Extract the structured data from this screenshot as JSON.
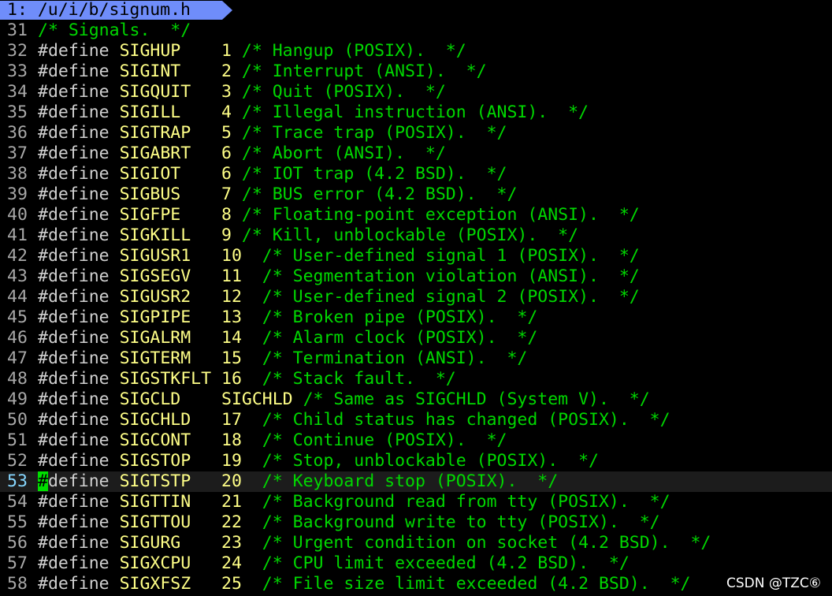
{
  "tab": {
    "label": "1: /u/i/b/signum.h"
  },
  "watermark": "CSDN @TZC⑥",
  "colors": {
    "background": "#000000",
    "tab": "#6f8dfa",
    "line_number": "#a8a8a8",
    "current_line_number": "#87d7ff",
    "keyword": "#d0d0d0",
    "identifier": "#ffff87",
    "comment": "#00d700",
    "cursor": "#00e000"
  },
  "lines": [
    {
      "num": "31",
      "comment": "/* Signals.  */"
    },
    {
      "num": "32",
      "kw": "#define",
      "name": "SIGHUP",
      "val": "1",
      "comment": "/* Hangup (POSIX).  */"
    },
    {
      "num": "33",
      "kw": "#define",
      "name": "SIGINT",
      "val": "2",
      "comment": "/* Interrupt (ANSI).  */"
    },
    {
      "num": "34",
      "kw": "#define",
      "name": "SIGQUIT",
      "val": "3",
      "comment": "/* Quit (POSIX).  */"
    },
    {
      "num": "35",
      "kw": "#define",
      "name": "SIGILL",
      "val": "4",
      "comment": "/* Illegal instruction (ANSI).  */"
    },
    {
      "num": "36",
      "kw": "#define",
      "name": "SIGTRAP",
      "val": "5",
      "comment": "/* Trace trap (POSIX).  */"
    },
    {
      "num": "37",
      "kw": "#define",
      "name": "SIGABRT",
      "val": "6",
      "comment": "/* Abort (ANSI).  */"
    },
    {
      "num": "38",
      "kw": "#define",
      "name": "SIGIOT",
      "val": "6",
      "comment": "/* IOT trap (4.2 BSD).  */"
    },
    {
      "num": "39",
      "kw": "#define",
      "name": "SIGBUS",
      "val": "7",
      "comment": "/* BUS error (4.2 BSD).  */"
    },
    {
      "num": "40",
      "kw": "#define",
      "name": "SIGFPE",
      "val": "8",
      "comment": "/* Floating-point exception (ANSI).  */"
    },
    {
      "num": "41",
      "kw": "#define",
      "name": "SIGKILL",
      "val": "9",
      "comment": "/* Kill, unblockable (POSIX).  */"
    },
    {
      "num": "42",
      "kw": "#define",
      "name": "SIGUSR1",
      "val": "10",
      "comment": " /* User-defined signal 1 (POSIX).  */"
    },
    {
      "num": "43",
      "kw": "#define",
      "name": "SIGSEGV",
      "val": "11",
      "comment": " /* Segmentation violation (ANSI).  */"
    },
    {
      "num": "44",
      "kw": "#define",
      "name": "SIGUSR2",
      "val": "12",
      "comment": " /* User-defined signal 2 (POSIX).  */"
    },
    {
      "num": "45",
      "kw": "#define",
      "name": "SIGPIPE",
      "val": "13",
      "comment": " /* Broken pipe (POSIX).  */"
    },
    {
      "num": "46",
      "kw": "#define",
      "name": "SIGALRM",
      "val": "14",
      "comment": " /* Alarm clock (POSIX).  */"
    },
    {
      "num": "47",
      "kw": "#define",
      "name": "SIGTERM",
      "val": "15",
      "comment": " /* Termination (ANSI).  */"
    },
    {
      "num": "48",
      "kw": "#define",
      "name": "SIGSTKFLT",
      "val": "16",
      "comment": " /* Stack fault.  */"
    },
    {
      "num": "49",
      "kw": "#define",
      "name": "SIGCLD",
      "val": "SIGCHLD",
      "comment": "/* Same as SIGCHLD (System V).  */"
    },
    {
      "num": "50",
      "kw": "#define",
      "name": "SIGCHLD",
      "val": "17",
      "comment": " /* Child status has changed (POSIX).  */"
    },
    {
      "num": "51",
      "kw": "#define",
      "name": "SIGCONT",
      "val": "18",
      "comment": " /* Continue (POSIX).  */"
    },
    {
      "num": "52",
      "kw": "#define",
      "name": "SIGSTOP",
      "val": "19",
      "comment": " /* Stop, unblockable (POSIX).  */"
    },
    {
      "num": "53",
      "kw": "#define",
      "name": "SIGTSTP",
      "val": "20",
      "comment": " /* Keyboard stop (POSIX).  */",
      "current": true
    },
    {
      "num": "54",
      "kw": "#define",
      "name": "SIGTTIN",
      "val": "21",
      "comment": " /* Background read from tty (POSIX).  */"
    },
    {
      "num": "55",
      "kw": "#define",
      "name": "SIGTTOU",
      "val": "22",
      "comment": " /* Background write to tty (POSIX).  */"
    },
    {
      "num": "56",
      "kw": "#define",
      "name": "SIGURG",
      "val": "23",
      "comment": " /* Urgent condition on socket (4.2 BSD).  */"
    },
    {
      "num": "57",
      "kw": "#define",
      "name": "SIGXCPU",
      "val": "24",
      "comment": " /* CPU limit exceeded (4.2 BSD).  */"
    },
    {
      "num": "58",
      "kw": "#define",
      "name": "SIGXFSZ",
      "val": "25",
      "comment": " /* File size limit exceeded (4.2 BSD).  */"
    }
  ]
}
